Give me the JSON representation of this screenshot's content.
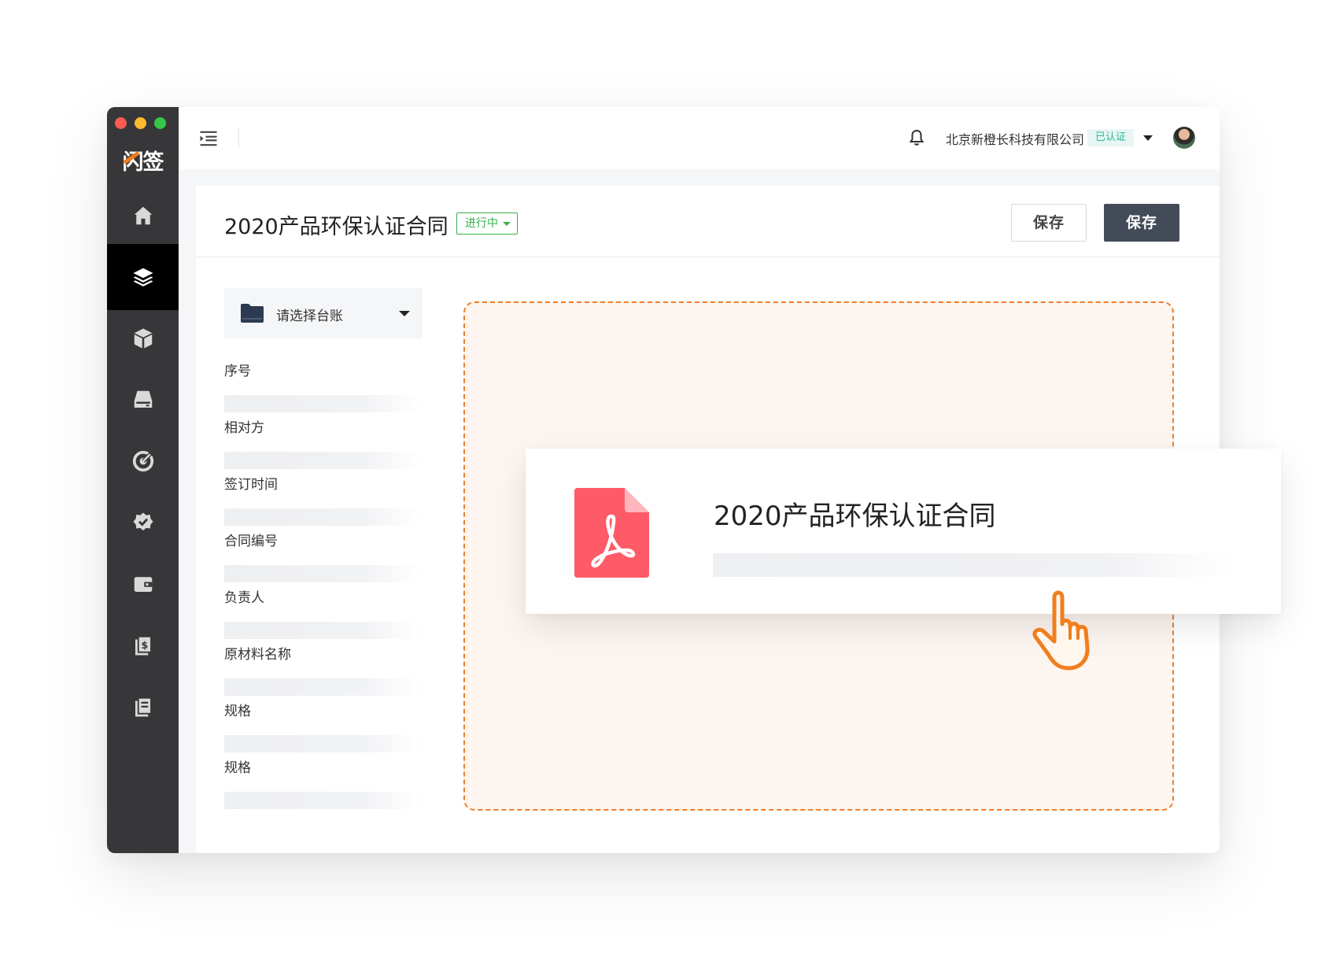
{
  "app": {
    "logo_text": "闪签"
  },
  "topbar": {
    "company_name": "北京新橙长科技有限公司",
    "verified_label": "已认证"
  },
  "sidebar": {
    "items": [
      {
        "icon": "home-icon"
      },
      {
        "icon": "layers-icon",
        "active": true
      },
      {
        "icon": "box-icon"
      },
      {
        "icon": "drive-icon"
      },
      {
        "icon": "target-icon"
      },
      {
        "icon": "verified-badge-icon"
      },
      {
        "icon": "wallet-icon"
      },
      {
        "icon": "invoice-icon"
      },
      {
        "icon": "book-icon"
      }
    ]
  },
  "page": {
    "title": "2020产品环保认证合同",
    "status": "进行中",
    "save_secondary_label": "保存",
    "save_primary_label": "保存"
  },
  "form": {
    "ledger_placeholder": "请选择台账",
    "fields": [
      {
        "label": "序号"
      },
      {
        "label": "相对方"
      },
      {
        "label": "签订时间"
      },
      {
        "label": "合同编号"
      },
      {
        "label": "负责人"
      },
      {
        "label": "原材料名称"
      },
      {
        "label": "规格"
      },
      {
        "label": "规格"
      }
    ]
  },
  "file_card": {
    "file_name": "2020产品环保认证合同",
    "file_icon": "pdf-icon"
  },
  "colors": {
    "sidebar_bg": "#373739",
    "primary_button": "#434b58",
    "status_green": "#34b24a",
    "verified_teal": "#2eb49b",
    "dropzone_border": "#f07e2b",
    "pdf_red": "#ff5a67"
  }
}
